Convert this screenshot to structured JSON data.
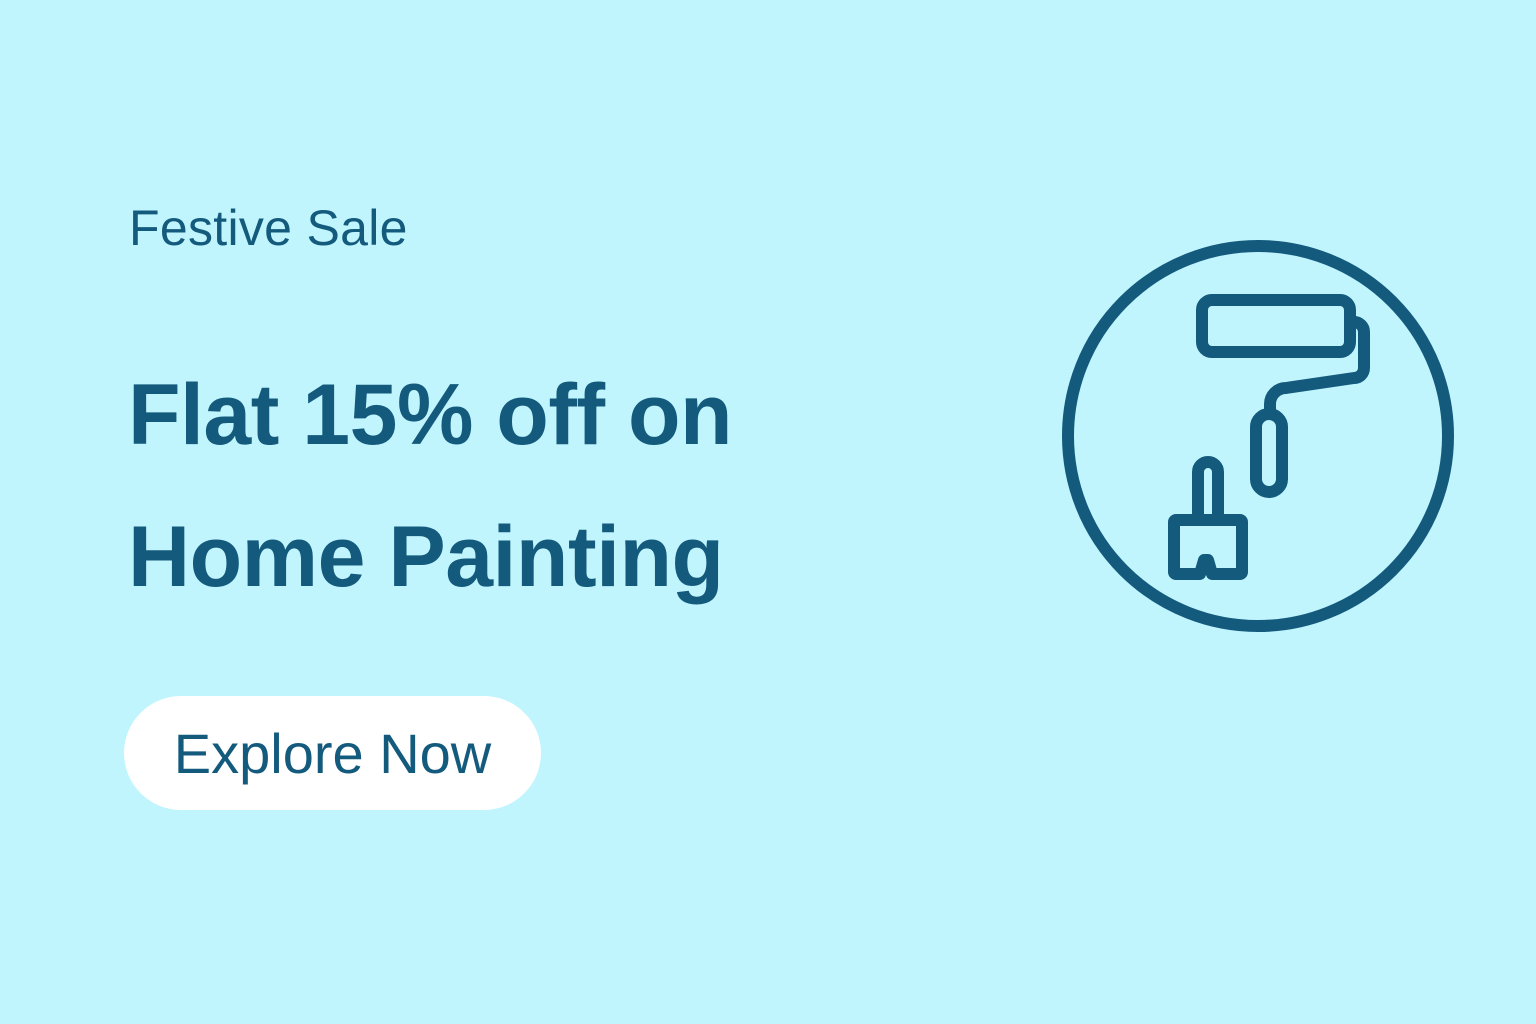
{
  "promo": {
    "eyebrow": "Festive Sale",
    "headline_line1": "Flat 15% off on",
    "headline_line2": "Home Painting",
    "cta_label": "Explore Now"
  },
  "illustration": {
    "icon": "paint-roller-and-brush-icon"
  },
  "colors": {
    "background": "#c1f5fd",
    "text": "#135a7d",
    "button": "#ffffff"
  }
}
